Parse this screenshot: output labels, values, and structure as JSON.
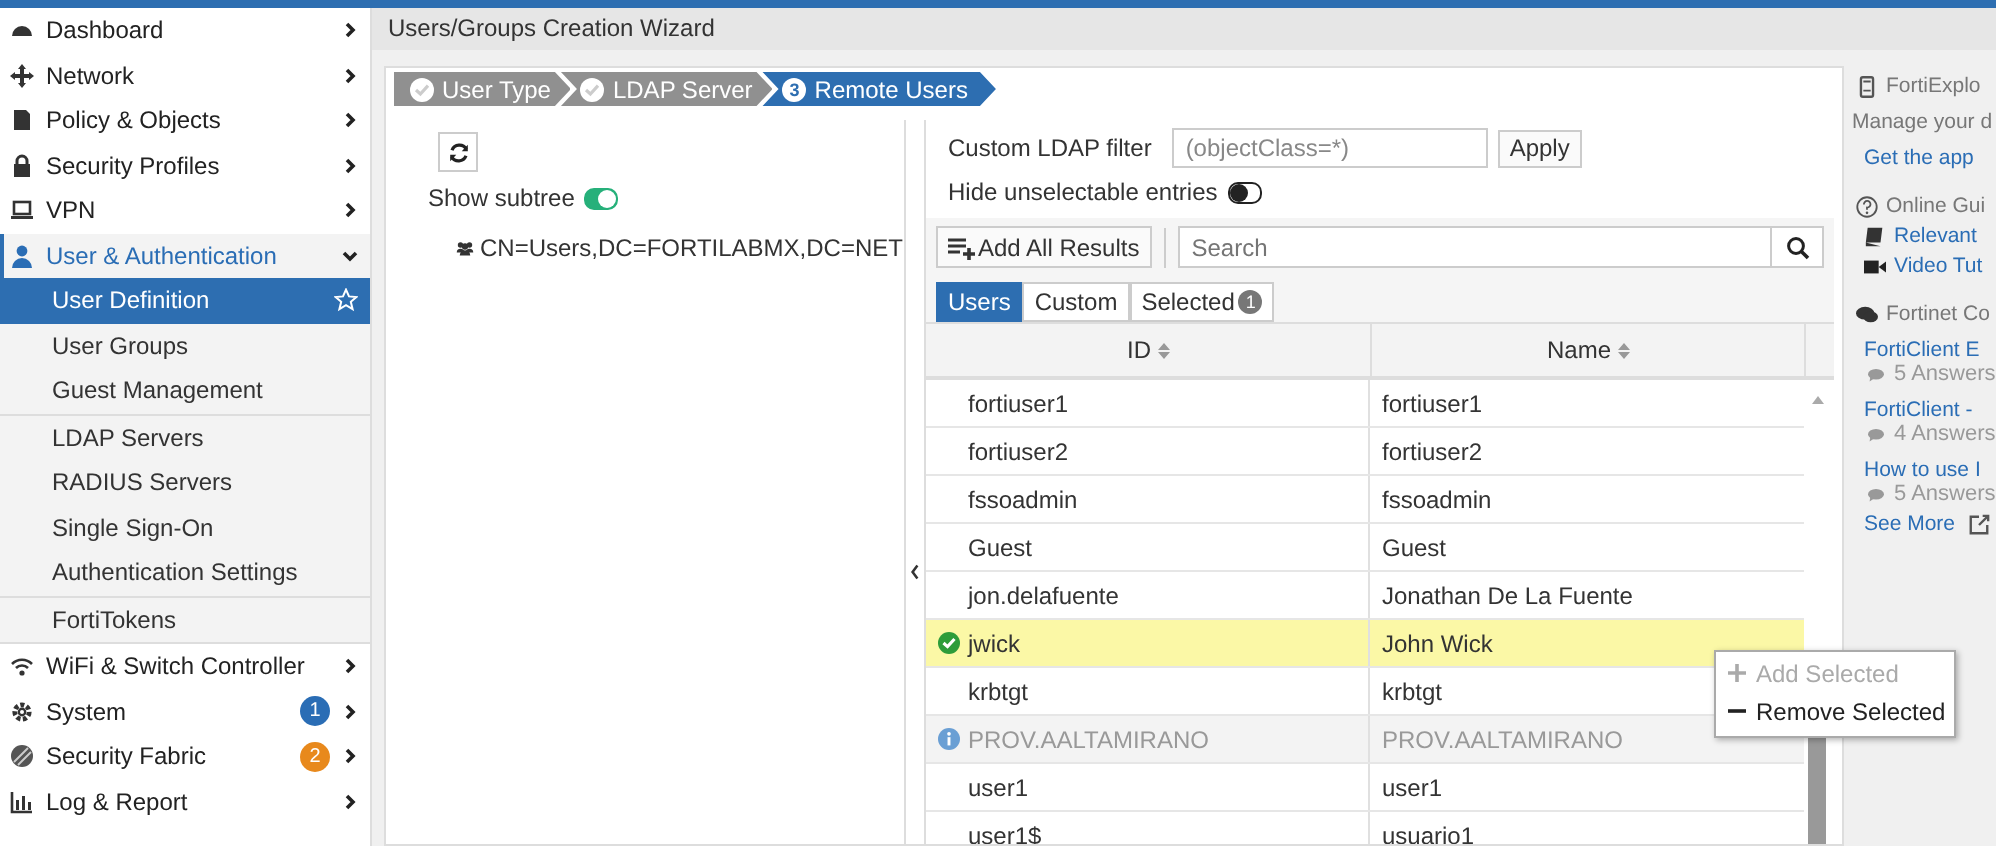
{
  "sidebar": {
    "items": [
      {
        "label": "Dashboard",
        "expanded": false
      },
      {
        "label": "Network",
        "expanded": false
      },
      {
        "label": "Policy & Objects",
        "expanded": false
      },
      {
        "label": "Security Profiles",
        "expanded": false
      },
      {
        "label": "VPN",
        "expanded": false
      },
      {
        "label": "User & Authentication",
        "expanded": true,
        "groups": [
          [
            {
              "label": "User Definition",
              "selected": true
            },
            {
              "label": "User Groups",
              "selected": false
            },
            {
              "label": "Guest Management",
              "selected": false
            }
          ],
          [
            {
              "label": "LDAP Servers",
              "selected": false
            },
            {
              "label": "RADIUS Servers",
              "selected": false
            },
            {
              "label": "Single Sign-On",
              "selected": false
            },
            {
              "label": "Authentication Settings",
              "selected": false
            }
          ],
          [
            {
              "label": "FortiTokens",
              "selected": false
            }
          ]
        ]
      },
      {
        "label": "WiFi & Switch Controller",
        "expanded": false
      },
      {
        "label": "System",
        "expanded": false,
        "badge": {
          "text": "1",
          "color": "#2a6db5"
        }
      },
      {
        "label": "Security Fabric",
        "expanded": false,
        "badge": {
          "text": "2",
          "color": "#e8891c"
        }
      },
      {
        "label": "Log & Report",
        "expanded": false
      }
    ]
  },
  "page_title": "Users/Groups Creation Wizard",
  "steps": [
    {
      "label": "User Type",
      "kind": "done",
      "selected": false
    },
    {
      "label": "LDAP Server",
      "kind": "done",
      "selected": false
    },
    {
      "label": "Remote Users",
      "kind": "current",
      "number": "3",
      "selected": true
    }
  ],
  "tree": {
    "show_subtree": {
      "label": "Show subtree",
      "on": true
    },
    "node": "CN=Users,DC=FORTILABMX,DC=NET"
  },
  "filter": {
    "label": "Custom LDAP filter",
    "value": "(objectClass=*)",
    "button": "Apply"
  },
  "hide_unselectable": {
    "label": "Hide unselectable entries",
    "on": false
  },
  "add_all": "Add All Results",
  "search": {
    "placeholder": "Search"
  },
  "tabs": [
    {
      "label": "Users",
      "selected": true
    },
    {
      "label": "Custom",
      "selected": false
    },
    {
      "label": "Selected",
      "selected": false,
      "badge": "1"
    }
  ],
  "table": {
    "columns": [
      "ID",
      "Name"
    ],
    "rows": [
      {
        "id": "fortiuser1",
        "name": "fortiuser1",
        "selected": false,
        "selectable": true
      },
      {
        "id": "fortiuser2",
        "name": "fortiuser2",
        "selected": false,
        "selectable": true
      },
      {
        "id": "fssoadmin",
        "name": "fssoadmin",
        "selected": false,
        "selectable": true
      },
      {
        "id": "Guest",
        "name": "Guest",
        "selected": false,
        "selectable": true
      },
      {
        "id": "jon.delafuente",
        "name": "Jonathan De La Fuente",
        "selected": false,
        "selectable": true
      },
      {
        "id": "jwick",
        "name": "John Wick",
        "selected": true,
        "selectable": true
      },
      {
        "id": "krbtgt",
        "name": "krbtgt",
        "selected": false,
        "selectable": true
      },
      {
        "id": "PROV.AALTAMIRANO",
        "name": "PROV.AALTAMIRANO",
        "selected": false,
        "selectable": false
      },
      {
        "id": "user1",
        "name": "user1",
        "selected": false,
        "selectable": true
      },
      {
        "id": "user1$",
        "name": "usuario1",
        "selected": false,
        "selectable": true
      }
    ]
  },
  "context_menu": [
    {
      "label": "Add Selected",
      "kind": "add",
      "disabled": true
    },
    {
      "label": "Remove Selected",
      "kind": "remove",
      "disabled": false
    }
  ],
  "help": {
    "app": {
      "title": "FortiExplo",
      "text": "Manage your d",
      "link": "Get the app"
    },
    "guides": {
      "title": "Online Gui",
      "links": [
        "Relevant",
        "Video Tut"
      ]
    },
    "community": {
      "title": "Fortinet Co",
      "posts": [
        {
          "title": "FortiClient E",
          "answers": "5 Answers"
        },
        {
          "title": "FortiClient -",
          "answers": "4 Answers"
        },
        {
          "title": "How to use I",
          "answers": "5 Answers"
        }
      ],
      "more": "See More"
    }
  }
}
